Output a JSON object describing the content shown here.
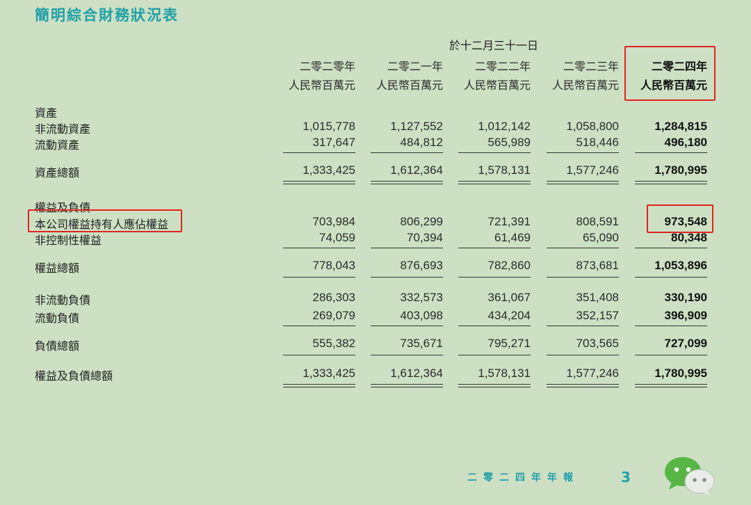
{
  "title": "簡明綜合財務狀況表",
  "period_label": "於十二月三十一日",
  "columns": [
    {
      "year": "二零二零年",
      "unit": "人民幣百萬元"
    },
    {
      "year": "二零二一年",
      "unit": "人民幣百萬元"
    },
    {
      "year": "二零二二年",
      "unit": "人民幣百萬元"
    },
    {
      "year": "二零二三年",
      "unit": "人民幣百萬元"
    },
    {
      "year": "二零二四年",
      "unit": "人民幣百萬元"
    }
  ],
  "sections": {
    "assets": "資產",
    "equity_liabilities": "權益及負債"
  },
  "rows": {
    "non_current_assets": {
      "label": "非流動資產",
      "values": [
        "1,015,778",
        "1,127,552",
        "1,012,142",
        "1,058,800",
        "1,284,815"
      ]
    },
    "current_assets": {
      "label": "流動資產",
      "values": [
        "317,647",
        "484,812",
        "565,989",
        "518,446",
        "496,180"
      ]
    },
    "total_assets": {
      "label": "資產總額",
      "values": [
        "1,333,425",
        "1,612,364",
        "1,578,131",
        "1,577,246",
        "1,780,995"
      ]
    },
    "equity_owners": {
      "label": "本公司權益持有人應佔權益",
      "values": [
        "703,984",
        "806,299",
        "721,391",
        "808,591",
        "973,548"
      ]
    },
    "non_controlling": {
      "label": "非控制性權益",
      "values": [
        "74,059",
        "70,394",
        "61,469",
        "65,090",
        "80,348"
      ]
    },
    "total_equity": {
      "label": "權益總額",
      "values": [
        "778,043",
        "876,693",
        "782,860",
        "873,681",
        "1,053,896"
      ]
    },
    "non_current_liabilities": {
      "label": "非流動負債",
      "values": [
        "286,303",
        "332,573",
        "361,067",
        "351,408",
        "330,190"
      ]
    },
    "current_liabilities": {
      "label": "流動負債",
      "values": [
        "269,079",
        "403,098",
        "434,204",
        "352,157",
        "396,909"
      ]
    },
    "total_liabilities": {
      "label": "負債總額",
      "values": [
        "555,382",
        "735,671",
        "795,271",
        "703,565",
        "727,099"
      ]
    },
    "total_equity_liabilities": {
      "label": "權益及負債總額",
      "values": [
        "1,333,425",
        "1,612,364",
        "1,578,131",
        "1,577,246",
        "1,780,995"
      ]
    }
  },
  "footer": {
    "report_label": "二零二四年年報",
    "page_number": "3"
  },
  "colors": {
    "accent": "#1fa0a8",
    "highlight": "#e0231c",
    "background": "#cde0c4"
  },
  "icons": [
    "wechat-chat-icon"
  ]
}
